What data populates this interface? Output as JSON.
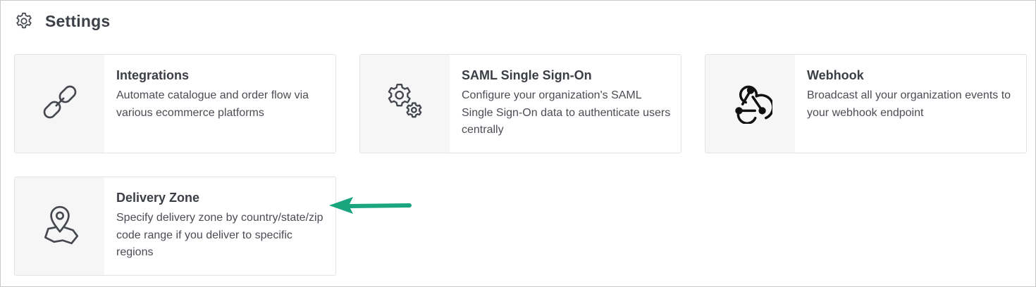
{
  "header": {
    "title": "Settings",
    "icon": "gear-icon"
  },
  "cards": [
    {
      "title": "Integrations",
      "description": "Automate catalogue and order flow via various ecommerce platforms",
      "icon": "link-icon"
    },
    {
      "title": "SAML Single Sign-On",
      "description": "Configure your organization's SAML Single Sign-On data to authenticate users centrally",
      "icon": "gears-icon"
    },
    {
      "title": "Webhook",
      "description": "Broadcast all your organization events to your webhook endpoint",
      "icon": "webhook-icon"
    },
    {
      "title": "Delivery Zone",
      "description": "Specify delivery zone by country/state/zip code range if you deliver to specific regions",
      "icon": "map-pin-icon"
    }
  ],
  "annotation": {
    "icon": "arrow-left-icon",
    "color": "#1aa57f"
  },
  "colors": {
    "text": "#3a3d44",
    "icon_pane": "#f6f6f6",
    "border": "#e3e3e3"
  }
}
